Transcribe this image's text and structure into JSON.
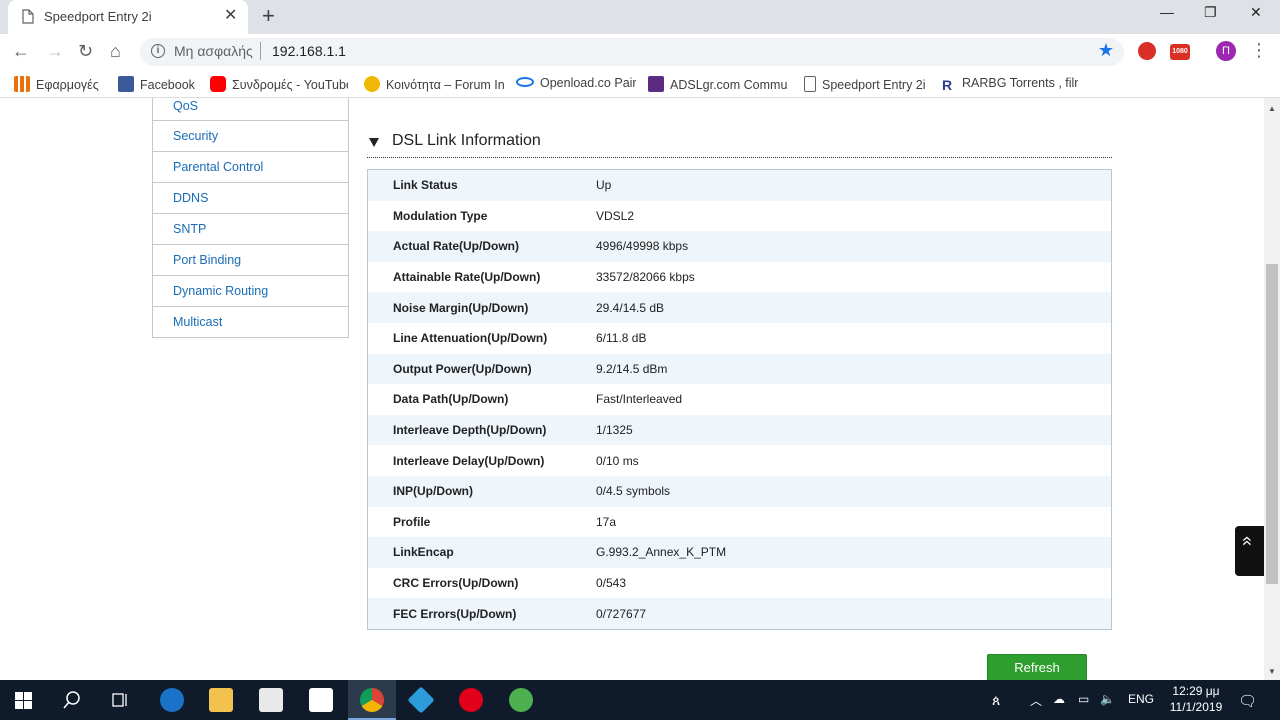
{
  "browser": {
    "tab_title": "Speedport Entry 2i",
    "tab_close": "✕",
    "new_tab": "+",
    "insecure_label": "Μη ασφαλής",
    "url": "192.168.1.1",
    "avatar_letter": "Π",
    "ext_badge": "1080",
    "win_min": "—",
    "win_max": "❐",
    "win_close": "✕"
  },
  "bookmarks": [
    {
      "label": "Εφαρμογές",
      "icon": "apps-grid-icon",
      "color": "#e8710a"
    },
    {
      "label": "Facebook",
      "icon": "facebook-icon",
      "color": "#3b5998"
    },
    {
      "label": "Συνδρομές - YouTube",
      "icon": "youtube-icon",
      "color": "#ff0000"
    },
    {
      "label": "Κοινότητα – Forum Insomnia",
      "icon": "forum-icon",
      "color": "#f2b705"
    },
    {
      "label": "Openload.co Pair",
      "icon": "openload-icon",
      "color": "#1a73e8"
    },
    {
      "label": "ADSLgr.com Community",
      "icon": "adslgr-icon",
      "color": "#5b2b82"
    },
    {
      "label": "Speedport Entry 2i",
      "icon": "page-icon",
      "color": "#5f6368"
    },
    {
      "label": "RARBG Torrents , filmy",
      "icon": "rarbg-icon",
      "color": "#2a3d8f"
    }
  ],
  "sidebar": {
    "items": [
      {
        "label": "QoS"
      },
      {
        "label": "Security"
      },
      {
        "label": "Parental Control"
      },
      {
        "label": "DDNS"
      },
      {
        "label": "SNTP"
      },
      {
        "label": "Port Binding"
      },
      {
        "label": "Dynamic Routing"
      },
      {
        "label": "Multicast"
      }
    ]
  },
  "section": {
    "title": "DSL Link Information"
  },
  "dsl_table": [
    {
      "label": "Link Status",
      "value": "Up"
    },
    {
      "label": "Modulation Type",
      "value": "VDSL2"
    },
    {
      "label": "Actual Rate(Up/Down)",
      "value": "4996/49998 kbps"
    },
    {
      "label": "Attainable Rate(Up/Down)",
      "value": "33572/82066 kbps"
    },
    {
      "label": "Noise Margin(Up/Down)",
      "value": "29.4/14.5 dB"
    },
    {
      "label": "Line Attenuation(Up/Down)",
      "value": "6/11.8 dB"
    },
    {
      "label": "Output Power(Up/Down)",
      "value": "9.2/14.5 dBm"
    },
    {
      "label": "Data Path(Up/Down)",
      "value": "Fast/Interleaved"
    },
    {
      "label": "Interleave Depth(Up/Down)",
      "value": "1/1325"
    },
    {
      "label": "Interleave Delay(Up/Down)",
      "value": "0/10 ms"
    },
    {
      "label": "INP(Up/Down)",
      "value": "0/4.5 symbols"
    },
    {
      "label": "Profile",
      "value": "17a"
    },
    {
      "label": "LinkEncap",
      "value": "G.993.2_Annex_K_PTM"
    },
    {
      "label": "CRC Errors(Up/Down)",
      "value": "0/543"
    },
    {
      "label": "FEC Errors(Up/Down)",
      "value": "0/727677"
    }
  ],
  "refresh_label": "Refresh",
  "taskbar": {
    "lang": "ENG",
    "time": "12:29 μμ",
    "date": "11/1/2019"
  },
  "colors": {
    "accent_green": "#2e9e2e",
    "link_blue": "#1a6db5",
    "row_tint": "#eef5fb"
  }
}
